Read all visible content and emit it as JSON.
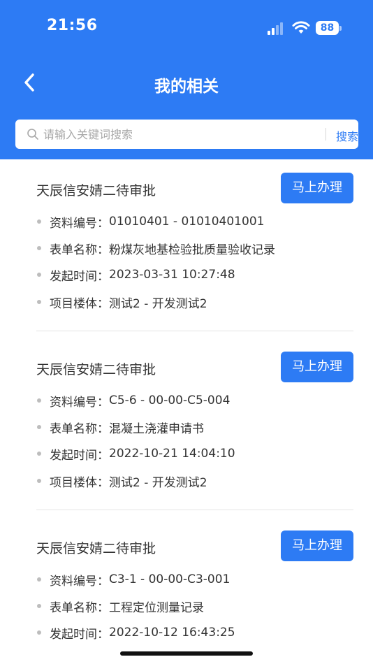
{
  "status_bar": {
    "time": "21:56",
    "battery": "88"
  },
  "header": {
    "title": "我的相关",
    "back_icon": "chevron-left-icon"
  },
  "search": {
    "placeholder": "请输入关键词搜索",
    "button_label": "搜索"
  },
  "colors": {
    "primary": "#2d7bf4",
    "text": "#333333",
    "placeholder": "#a8a8a8"
  },
  "cards": [
    {
      "title": "天辰信安婧二待审批",
      "action_label": "马上办理",
      "fields": [
        {
          "label": "资料编号：",
          "value": "01010401 - 01010401001"
        },
        {
          "label": "表单名称：",
          "value": "粉煤灰地基检验批质量验收记录"
        },
        {
          "label": "发起时间：",
          "value": "2023-03-31 10:27:48"
        },
        {
          "label": "项目楼体：",
          "value": "测试2 - 开发测试2"
        }
      ]
    },
    {
      "title": "天辰信安婧二待审批",
      "action_label": "马上办理",
      "fields": [
        {
          "label": "资料编号：",
          "value": "C5-6 - 00-00-C5-004"
        },
        {
          "label": "表单名称：",
          "value": "混凝土浇灌申请书"
        },
        {
          "label": "发起时间：",
          "value": "2022-10-21 14:04:10"
        },
        {
          "label": "项目楼体：",
          "value": "测试2 - 开发测试2"
        }
      ]
    },
    {
      "title": "天辰信安婧二待审批",
      "action_label": "马上办理",
      "fields": [
        {
          "label": "资料编号：",
          "value": "C3-1 - 00-00-C3-001"
        },
        {
          "label": "表单名称：",
          "value": "工程定位测量记录"
        },
        {
          "label": "发起时间：",
          "value": "2022-10-12 16:43:25"
        }
      ]
    }
  ]
}
